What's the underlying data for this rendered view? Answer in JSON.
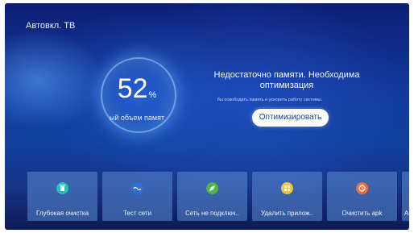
{
  "header": {
    "title": "Автовкл. ТВ"
  },
  "memory": {
    "percent": "52",
    "percent_sign": "%",
    "label": "ый объем памят"
  },
  "message": {
    "title": "Недостаточно памяти. Необходима оптимизация",
    "subtitle": "бы освободить память и ускорить работу системы.",
    "button_label": "Оптимизировать"
  },
  "tiles": [
    {
      "label": "Глубокая очистка",
      "icon": "trash-icon",
      "color": "#27c3b9"
    },
    {
      "label": "Тест сети",
      "icon": "network-wave-icon",
      "color": "#2f6fd2"
    },
    {
      "label": "Сеть не подключ..",
      "icon": "leaf-icon",
      "color": "#4fb548"
    },
    {
      "label": "Удалить прилож..",
      "icon": "apps-icon",
      "color": "#f4c43a"
    },
    {
      "label": "Очистить apk",
      "icon": "clean-apk-icon",
      "color": "#f16a3b"
    },
    {
      "label": "Ав"
    }
  ],
  "colors": {
    "background": "#123a9e",
    "tile": "#5a8cd2",
    "button_text": "#1e3d8a"
  }
}
